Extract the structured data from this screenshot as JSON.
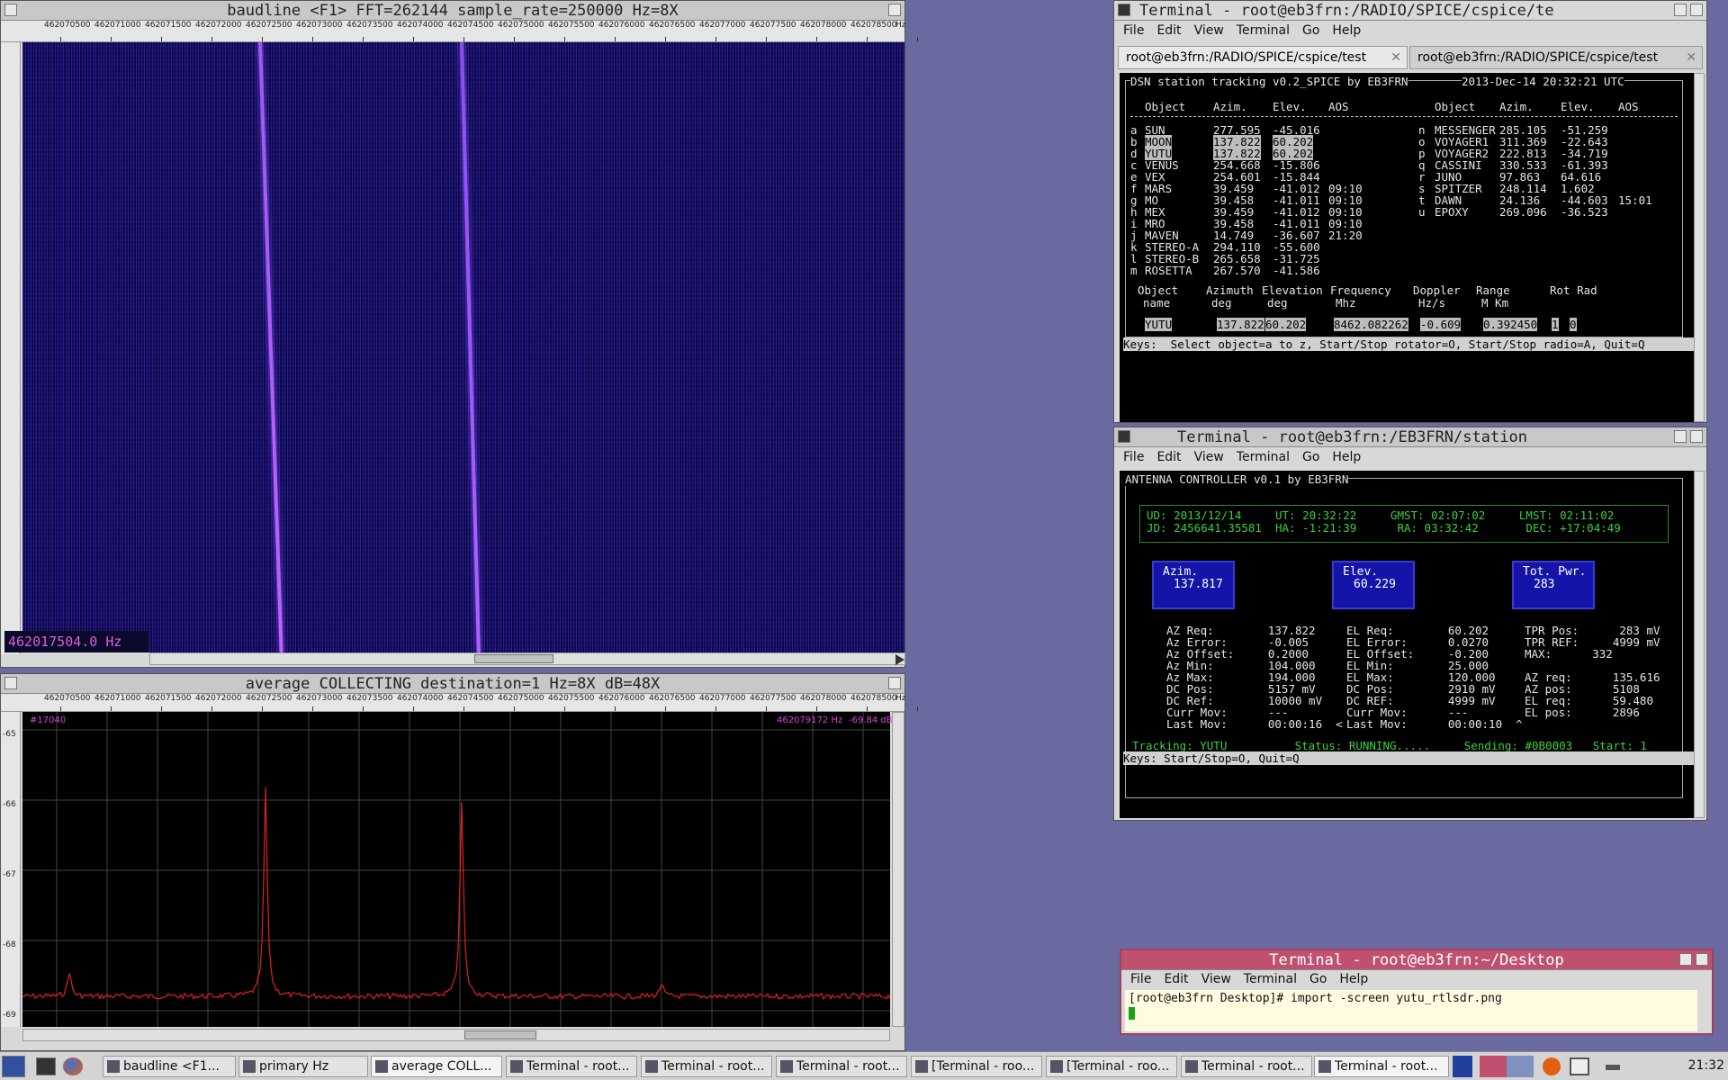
{
  "baudline": {
    "title": "baudline  <F1> FFT=262144 sample_rate=250000 Hz=8X",
    "readout": "462017504.0 Hz",
    "ticks": [
      "462070500",
      "462071000",
      "462071500",
      "462072000",
      "462072500",
      "462073000",
      "462073500",
      "462074000",
      "462074500",
      "462075000",
      "462075500",
      "462076000",
      "462076500",
      "462077000",
      "462077500",
      "462078000",
      "462078500",
      "Hz"
    ]
  },
  "average": {
    "title": "average  COLLECTING destination=1 Hz=8X dB=48X",
    "left_label": "#17040",
    "right_freq": "462079172 Hz",
    "right_db": "-69.84 dB",
    "y_ticks": [
      "-65",
      "-66",
      "-67",
      "-68",
      "-69"
    ]
  },
  "term1": {
    "title": "Terminal - root@eb3frn:/RADIO/SPICE/cspice/te",
    "menu": [
      "File",
      "Edit",
      "View",
      "Terminal",
      "Go",
      "Help"
    ],
    "tabs": [
      "root@eb3frn:/RADIO/SPICE/cspice/test",
      "root@eb3frn:/RADIO/SPICE/cspice/test"
    ],
    "banner": "DSN station tracking v0.2_SPICE by EB3FRN",
    "datetime": "2013-Dec-14 20:32:21 UTC",
    "headers": [
      "Object",
      "Azim.",
      "Elev.",
      "AOS",
      "Object",
      "Azim.",
      "Elev.",
      "AOS"
    ],
    "left_rows": [
      [
        "a",
        "SUN",
        "277.595",
        "-45.016",
        ""
      ],
      [
        "b",
        "MOON",
        "137.822",
        "60.202",
        ""
      ],
      [
        "d",
        "YUTU",
        "137.822",
        "60.202",
        ""
      ],
      [
        "c",
        "VENUS",
        "254.668",
        "-15.806",
        ""
      ],
      [
        "e",
        "VEX",
        "254.601",
        "-15.844",
        ""
      ],
      [
        "f",
        "MARS",
        "39.459",
        "-41.012",
        "09:10"
      ],
      [
        "g",
        "MO",
        "39.458",
        "-41.011",
        "09:10"
      ],
      [
        "h",
        "MEX",
        "39.459",
        "-41.012",
        "09:10"
      ],
      [
        "i",
        "MRO",
        "39.458",
        "-41.011",
        "09:10"
      ],
      [
        "j",
        "MAVEN",
        "14.749",
        "-36.607",
        "21:20"
      ],
      [
        "k",
        "STEREO-A",
        "294.110",
        "-55.600",
        ""
      ],
      [
        "l",
        "STEREO-B",
        "265.658",
        "-31.725",
        ""
      ],
      [
        "m",
        "ROSETTA",
        "267.570",
        "-41.586",
        ""
      ]
    ],
    "right_rows": [
      [
        "n",
        "MESSENGER",
        "285.105",
        "-51.259",
        ""
      ],
      [
        "o",
        "VOYAGER1",
        "311.369",
        "-22.643",
        ""
      ],
      [
        "p",
        "VOYAGER2",
        "222.813",
        "-34.719",
        ""
      ],
      [
        "q",
        "CASSINI",
        "330.533",
        "-61.393",
        ""
      ],
      [
        "r",
        "JUNO",
        "97.863",
        "64.616",
        ""
      ],
      [
        "s",
        "SPITZER",
        "248.114",
        "1.602",
        ""
      ],
      [
        "t",
        "DAWN",
        "24.136",
        "-44.603",
        "15:01"
      ],
      [
        "u",
        "EPOXY",
        "269.096",
        "-36.523",
        ""
      ]
    ],
    "bottom_headers": [
      [
        "Object",
        "name"
      ],
      [
        "Azimuth",
        "deg"
      ],
      [
        "Elevation",
        "deg"
      ],
      [
        "Frequency",
        "Mhz"
      ],
      [
        "Doppler",
        "Hz/s"
      ],
      [
        "Range",
        "M Km"
      ],
      [
        "Rot Rad",
        ""
      ]
    ],
    "bottom_values": [
      "YUTU",
      "137.822",
      "60.202",
      "8462.082262",
      "-0.609",
      "0.392450",
      "1",
      "0"
    ],
    "keys": "Keys:  Select object=a to z, Start/Stop rotator=O, Start/Stop radio=A, Quit=Q"
  },
  "term2": {
    "title": "Terminal - root@eb3frn:/EB3FRN/station",
    "menu": [
      "File",
      "Edit",
      "View",
      "Terminal",
      "Go",
      "Help"
    ],
    "banner": "ANTENNA CONTROLLER v0.1 by EB3FRN",
    "time_line1": "UD: 2013/12/14     UT: 20:32:22     GMST: 02:07:02     LMST: 02:11:02",
    "time_line2": "JD: 2456641.35581  HA: -1:21:39      RA: 03:32:42       DEC: +17:04:49",
    "az_box": [
      "Azim.",
      "137.817"
    ],
    "el_box": [
      "Elev.",
      "60.229"
    ],
    "pwr_box": [
      "Tot. Pwr.",
      "283"
    ],
    "col1": [
      "AZ Req:        137.822",
      "Az Error:      -0.005",
      "Az Offset:     0.2000",
      "Az Min:        104.000",
      "Az Max:        194.000",
      "DC Pos:        5157 mV",
      "DC Ref:        10000 mV",
      "Curr Mov:      ---",
      "Last Mov:      00:00:16  <"
    ],
    "col2": [
      "EL Req:        60.202",
      "EL Error:      0.0270",
      "EL Offset:     -0.200",
      "EL Min:        25.000",
      "EL Max:        120.000",
      "DC Pos:        2910 mV",
      "DC REF:        4999 mV",
      "Curr Mov:      ---",
      "Last Mov:      00:00:10  ^"
    ],
    "col3": [
      "TPR Pos:      283 mV",
      "TPR REF:     4999 mV",
      "MAX:      332",
      "",
      "AZ req:      135.616",
      "AZ pos:      5108",
      "EL req:      59.480",
      "EL pos:      2896"
    ],
    "status": "Tracking: YUTU          Status: RUNNING.....     Sending: #0B0003   Start: 1",
    "keys": "Keys: Start/Stop=O, Quit=Q"
  },
  "term3": {
    "title": "Terminal - root@eb3frn:~/Desktop",
    "menu": [
      "File",
      "Edit",
      "View",
      "Terminal",
      "Go",
      "Help"
    ],
    "prompt": "[root@eb3frn Desktop]# import -screen yutu_rtlsdr.png"
  },
  "taskbar": {
    "tasks": [
      "baudline  <F1...",
      "primary Hz",
      "average  COLL...",
      "Terminal - root...",
      "Terminal - root...",
      "Terminal - root...",
      "[Terminal - roo...",
      "[Terminal - roo...",
      "Terminal - root...",
      "Terminal - root..."
    ],
    "clock": "21:32"
  },
  "colors": {
    "waterfall": "#1a1070",
    "trace": "#e02020",
    "grid": "#444444",
    "term_green": "#3bd13b",
    "box_blue": "#1414a8"
  }
}
